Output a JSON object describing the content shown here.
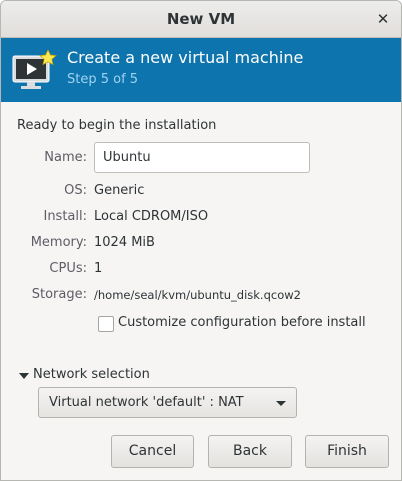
{
  "window": {
    "title": "New VM"
  },
  "banner": {
    "title": "Create a new virtual machine",
    "step": "Step 5 of 5"
  },
  "summary": {
    "heading": "Ready to begin the installation",
    "name_label": "Name:",
    "name_value": "Ubuntu",
    "os_label": "OS:",
    "os_value": "Generic",
    "install_label": "Install:",
    "install_value": "Local CDROM/ISO",
    "memory_label": "Memory:",
    "memory_value": "1024 MiB",
    "cpus_label": "CPUs:",
    "cpus_value": "1",
    "storage_label": "Storage:",
    "storage_value": "/home/seal/kvm/ubuntu_disk.qcow2"
  },
  "customize": {
    "label": "Customize configuration before install",
    "checked": false
  },
  "network": {
    "expander_label": "Network selection",
    "selected": "Virtual network 'default' : NAT"
  },
  "buttons": {
    "cancel": "Cancel",
    "back": "Back",
    "finish": "Finish"
  },
  "colors": {
    "banner": "#0e74ad",
    "banner_step": "#9fd2f2"
  },
  "icons": {
    "close": "close-icon",
    "banner": "vm-monitor-icon"
  }
}
